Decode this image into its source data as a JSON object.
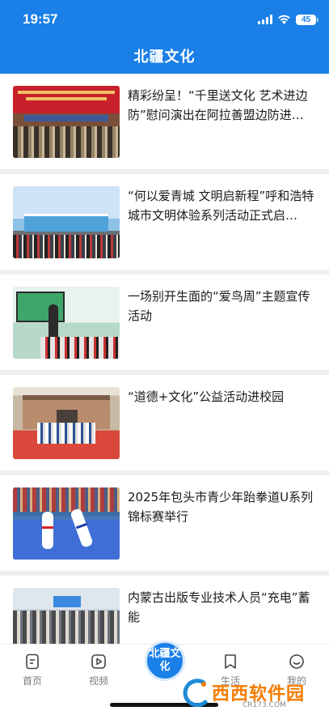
{
  "status_bar": {
    "time": "19:57",
    "battery": "45"
  },
  "header": {
    "title": "北疆文化"
  },
  "feed": {
    "items": [
      {
        "title": "精彩纷呈！“千里送文化 艺术进边防”慰问演出在阿拉善盟边防进…",
        "image": "performance-hall-photo"
      },
      {
        "title": "“何以爱青城 文明启新程”呼和浩特城市文明体验系列活动正式启…",
        "image": "outdoor-ceremony-photo"
      },
      {
        "title": "一场别开生面的“爱鸟周”主题宣传活动",
        "image": "classroom-presentation-photo"
      },
      {
        "title": "“道德+文化”公益活动进校园",
        "image": "school-entrance-photo"
      },
      {
        "title": "2025年包头市青少年跆拳道U系列锦标赛举行",
        "image": "taekwondo-match-photo"
      },
      {
        "title": "内蒙古出版专业技术人员“充电”蓄能",
        "image": "lecture-hall-photo"
      }
    ]
  },
  "tabbar": {
    "home_label": "首页",
    "video_label": "视频",
    "center_label": "北疆文化",
    "life_label": "生活",
    "mine_label": "我的",
    "accent": "#1a7fe6"
  },
  "watermark": {
    "text": "西西软件园",
    "site": "CR173.COM"
  }
}
